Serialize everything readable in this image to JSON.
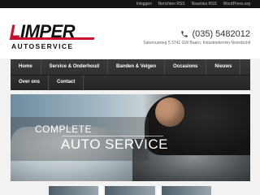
{
  "topbar": {
    "links": [
      "Inloggen",
      "Berichten RSS",
      "Reacties RSS",
      "WordPress.org"
    ]
  },
  "logo": {
    "text": "IMPER",
    "first_letter": "L",
    "subtitle": "AUTOSERVICE",
    "brand_red": "#c8102e"
  },
  "contact": {
    "phone": "(035) 5482012",
    "phone_icon": "phone-icon",
    "address": "Saturnusweg 5 3741 GW Baarn, Industrieterrein Noordschil"
  },
  "nav": {
    "row1": [
      "Home",
      "Service & Onderhoud",
      "Banden & Velgen",
      "Occasions",
      "Nieuws"
    ],
    "row2": [
      "Over ons",
      "Contact"
    ]
  },
  "hero": {
    "title_line1": "COMPLETE",
    "title_line2": "AUTO SERVICE"
  }
}
